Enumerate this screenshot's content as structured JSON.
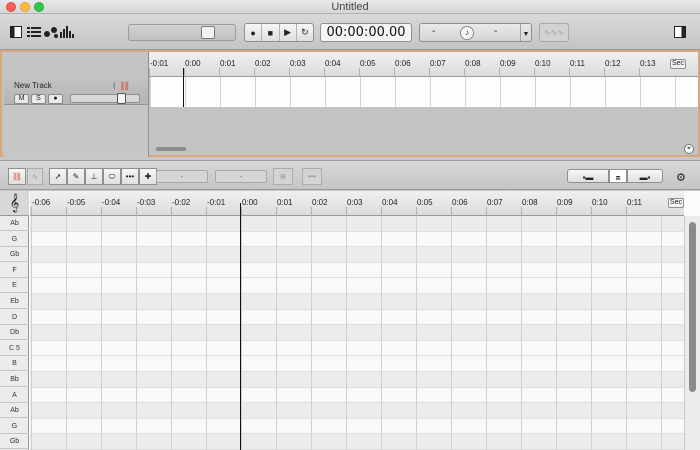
{
  "window": {
    "title": "Untitled"
  },
  "toolbar": {
    "transport": {
      "record": "●",
      "stop": "■",
      "play": "▶",
      "cycle": "↻"
    },
    "timecode": "00:00:00.00",
    "tempo": {
      "left": "-",
      "right": "-",
      "metronome": "♪"
    },
    "greyed_label": "∿∿∿"
  },
  "tracks": {
    "track_name": "New Track",
    "mute": "M",
    "solo": "S",
    "record": "●",
    "ruler_labels": [
      "-0:01",
      "0:00",
      "0:01",
      "0:02",
      "0:03",
      "0:04",
      "0:05",
      "0:06",
      "0:07",
      "0:08",
      "0:09",
      "0:10",
      "0:11",
      "0:12",
      "0:13"
    ],
    "unit": "Sec"
  },
  "editor": {
    "field1": "-",
    "field2": "-",
    "ruler_labels": [
      "-0:06",
      "-0:05",
      "-0:04",
      "-0:03",
      "-0:02",
      "-0:01",
      "0:00",
      "0:01",
      "0:02",
      "0:03",
      "0:04",
      "0:05",
      "0:06",
      "0:07",
      "0:08",
      "0:09",
      "0:10",
      "0:11"
    ],
    "unit": "Sec",
    "clef": "𝄞",
    "notes": [
      "Ab",
      "G",
      "Gb",
      "F",
      "E",
      "Eb",
      "D",
      "Db",
      "C 5",
      "B",
      "Bb",
      "A",
      "Ab",
      "G",
      "Gb"
    ]
  },
  "colors": {
    "accent_border": "#d6a87a",
    "playhead": "#111111"
  },
  "icons": {
    "library": "sidebar-toggle-icon",
    "inspector": "inspector-toggle-icon",
    "pointer": "pointer-tool-icon",
    "gear": "gear-icon"
  }
}
